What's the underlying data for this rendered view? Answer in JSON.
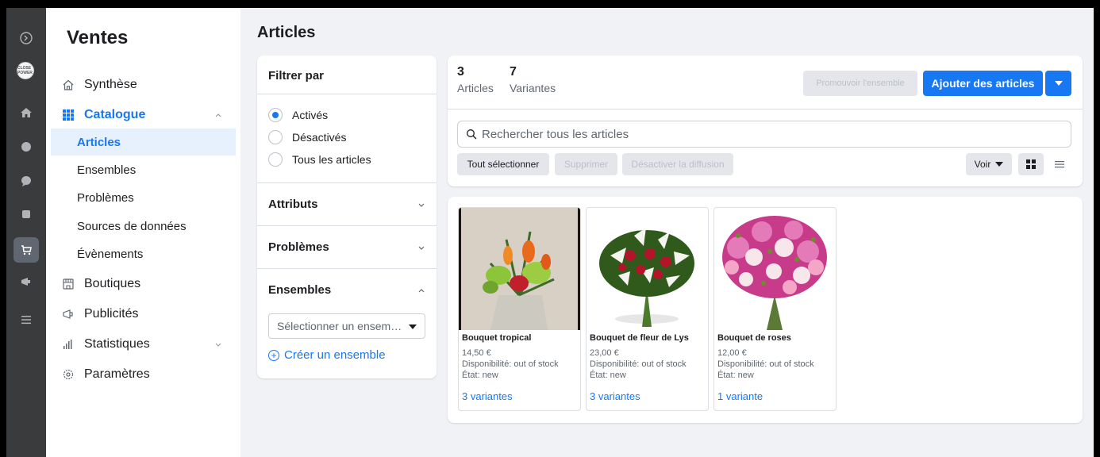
{
  "rail": {
    "avatar_text": "CLOSE POWER",
    "icons": [
      "logo-icon",
      "avatar",
      "home-icon",
      "whatsapp-icon",
      "messenger-icon",
      "pages-icon",
      "shop-icon",
      "ads-icon",
      "menu-icon"
    ]
  },
  "sidebar": {
    "title": "Ventes",
    "items": [
      {
        "label": "Synthèse",
        "icon": "house-icon"
      },
      {
        "label": "Catalogue",
        "icon": "grid-icon"
      },
      {
        "label": "Boutiques",
        "icon": "store-icon"
      },
      {
        "label": "Publicités",
        "icon": "megaphone-icon"
      },
      {
        "label": "Statistiques",
        "icon": "bar-chart-icon"
      },
      {
        "label": "Paramètres",
        "icon": "gear-icon"
      }
    ],
    "catalogue_sub": [
      "Articles",
      "Ensembles",
      "Problèmes",
      "Sources de données",
      "Évènements"
    ]
  },
  "main": {
    "title": "Articles"
  },
  "filter": {
    "title": "Filtrer par",
    "status_options": [
      "Activés",
      "Désactivés",
      "Tous les articles"
    ],
    "selected": "Activés",
    "sections": [
      "Attributs",
      "Problèmes",
      "Ensembles"
    ],
    "select_placeholder": "Sélectionner un ensem…",
    "create_label": "Créer un ensemble"
  },
  "summary": {
    "articles_count": "3",
    "articles_label": "Articles",
    "variants_count": "7",
    "variants_label": "Variantes",
    "promote_label": "Promouvoir l'ensemble",
    "add_label": "Ajouter des articles"
  },
  "toolbar": {
    "search_placeholder": "Rechercher tous les articles",
    "select_all": "Tout sélectionner",
    "delete": "Supprimer",
    "disable": "Désactiver la diffusion",
    "view": "Voir"
  },
  "products": [
    {
      "name": "Bouquet tropical",
      "price": "14,50 €",
      "availability": "Disponibilité: out of stock",
      "state": "État: new",
      "variants": "3 variantes"
    },
    {
      "name": "Bouquet de fleur de Lys",
      "price": "23,00 €",
      "availability": "Disponibilité: out of stock",
      "state": "État: new",
      "variants": "3 variantes"
    },
    {
      "name": "Bouquet de roses",
      "price": "12,00 €",
      "availability": "Disponibilité: out of stock",
      "state": "État: new",
      "variants": "1 variante"
    }
  ],
  "colors": {
    "accent": "#1877f2",
    "rail": "#3a3b3c",
    "background": "#f0f2f5"
  }
}
